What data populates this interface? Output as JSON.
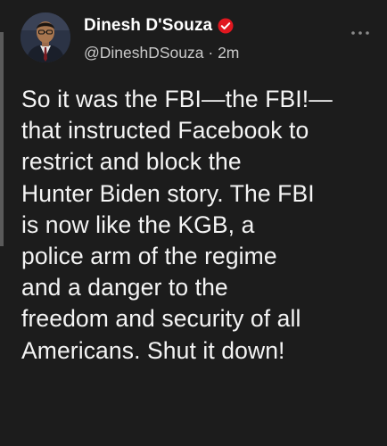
{
  "author": {
    "display_name": "Dinesh D'Souza",
    "handle": "@DineshDSouza",
    "separator": " · ",
    "timestamp": "2m",
    "verified": true
  },
  "icons": {
    "verified": "verified-badge-icon",
    "more": "more-options-icon",
    "avatar": "profile-avatar"
  },
  "colors": {
    "background": "#1c1c1c",
    "verified_badge": "#e0171f",
    "secondary_text": "#c9c9c9"
  },
  "tweet": {
    "lines": [
      "So it was the FBI—the FBI!—",
      "that instructed Facebook to",
      "restrict and block the",
      "Hunter Biden story. The FBI",
      "is now like the KGB, a",
      "police arm of the regime",
      "and a danger to the",
      "freedom and security of all",
      "Americans. Shut it down!"
    ]
  }
}
